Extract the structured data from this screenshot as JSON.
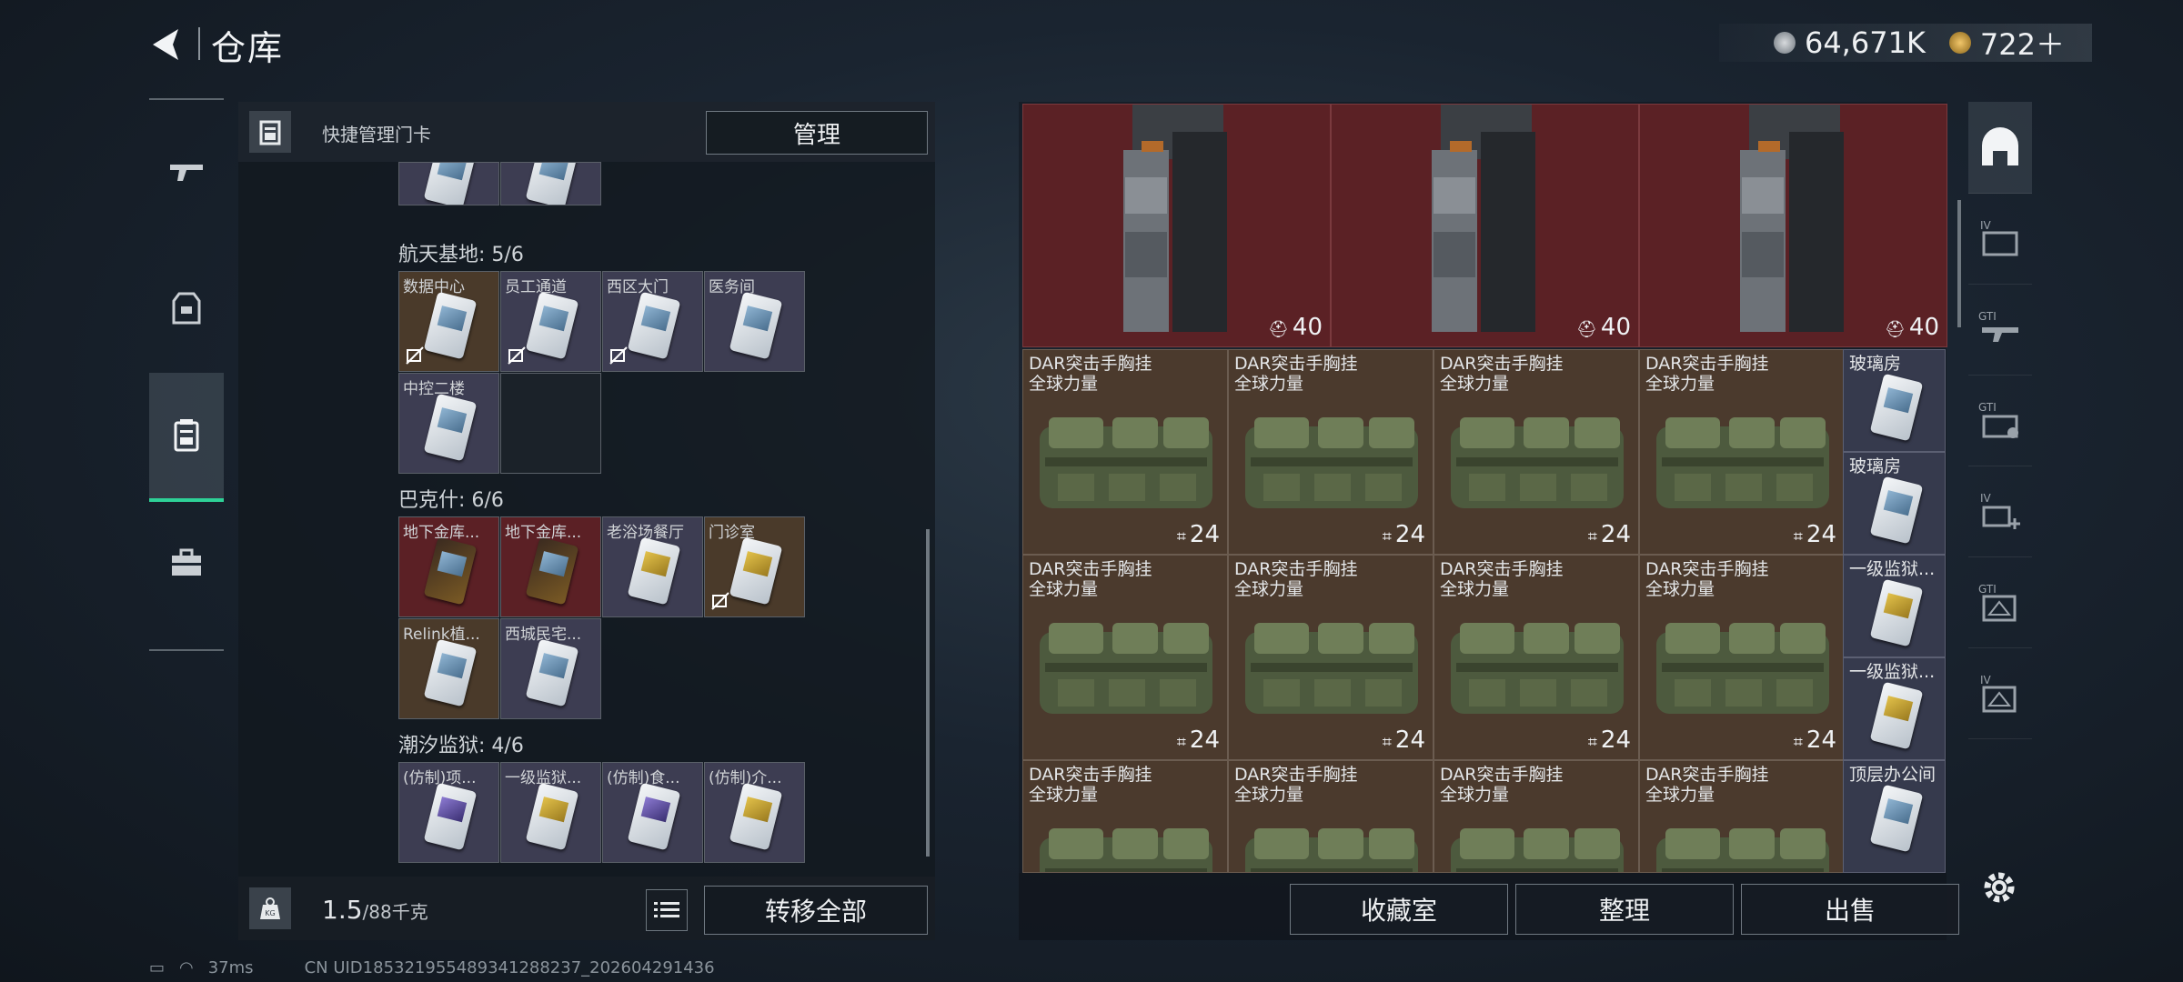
{
  "header": {
    "title": "仓库"
  },
  "currency": {
    "coin_value": "64,671K",
    "token_value": "722＋",
    "coin_icon": "coin-icon",
    "token_icon": "token-icon"
  },
  "left_panel": {
    "title": "快捷管理门卡",
    "manage_label": "管理",
    "sections": [
      {
        "name": "航天基地: 5/6",
        "cells": [
          "数据中心",
          "员工通道",
          "西区大门",
          "医务间",
          "中控二楼",
          ""
        ]
      },
      {
        "name": "巴克什: 6/6",
        "cells": [
          "地下金库...",
          "地下金库...",
          "老浴场餐厅",
          "门诊室",
          "Relink植...",
          "西城民宅..."
        ]
      },
      {
        "name": "潮汐监狱: 4/6",
        "cells": [
          "(仿制)项...",
          "一级监狱...",
          "(仿制)食...",
          "(仿制)介..."
        ]
      }
    ],
    "weight_value": "1.5",
    "weight_max": "/88千克",
    "transfer_label": "转移全部"
  },
  "right_panel": {
    "vests": [
      {
        "count": "40"
      },
      {
        "count": "40"
      },
      {
        "count": "40"
      }
    ],
    "rig_name": "DAR突击手胸挂\n全球力量",
    "rig_count": "24",
    "slots": [
      "玻璃房",
      "玻璃房",
      "一级监狱...",
      "一级监狱...",
      "顶层办公间"
    ],
    "buttons": {
      "collection": "收藏室",
      "sort": "整理",
      "sell": "出售"
    }
  },
  "status_bar": {
    "ping": "37ms",
    "uid": "CN UID18532195548934128823​7_202604291436"
  },
  "colors": {
    "accent": "#2ed197",
    "vest_bg": "#5b2125",
    "rig_bg": "#4b3a2d"
  }
}
